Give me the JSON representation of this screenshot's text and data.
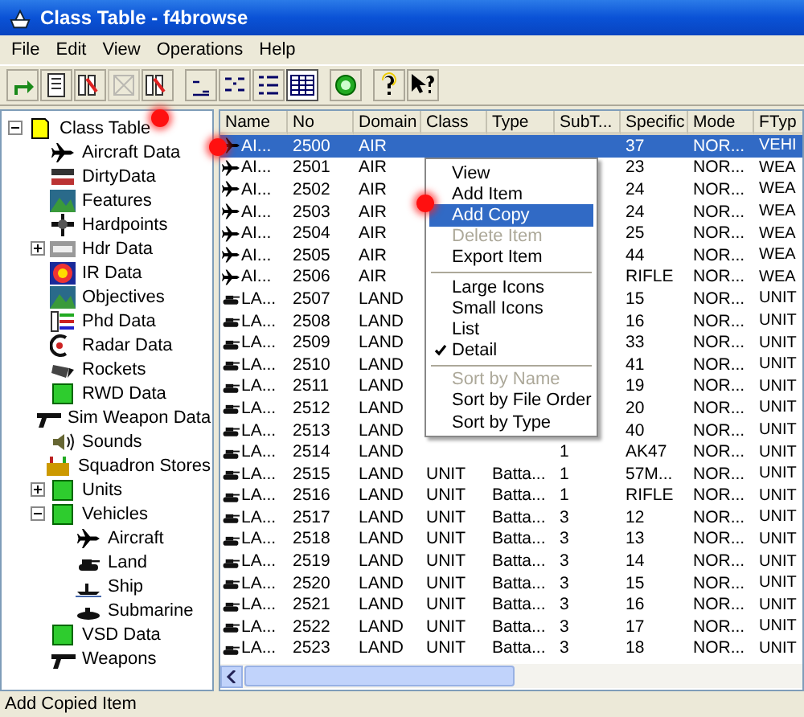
{
  "window": {
    "title": "Class Table - f4browse"
  },
  "menu": [
    "File",
    "Edit",
    "View",
    "Operations",
    "Help"
  ],
  "toolbar": [
    {
      "selected": false,
      "disabled": false
    },
    {
      "selected": false,
      "disabled": false
    },
    {
      "selected": false,
      "disabled": false
    },
    {
      "selected": false,
      "disabled": true
    },
    {
      "selected": false,
      "disabled": false
    },
    {
      "selected": false,
      "disabled": false
    },
    {
      "selected": false,
      "disabled": false
    },
    {
      "selected": false,
      "disabled": false
    },
    {
      "selected": true,
      "disabled": false
    },
    {
      "selected": false,
      "disabled": false
    },
    {
      "selected": false,
      "disabled": false
    },
    {
      "selected": false,
      "disabled": false
    }
  ],
  "tree": {
    "label": "Class Table",
    "expanded": true,
    "selected": false,
    "children": [
      {
        "label": "Aircraft Data"
      },
      {
        "label": "DirtyData"
      },
      {
        "label": "Features"
      },
      {
        "label": "Hardpoints"
      },
      {
        "label": "Hdr Data",
        "expanded": false
      },
      {
        "label": "IR Data"
      },
      {
        "label": "Objectives"
      },
      {
        "label": "Phd Data"
      },
      {
        "label": "Radar Data"
      },
      {
        "label": "Rockets"
      },
      {
        "label": "RWD Data"
      },
      {
        "label": "Sim Weapon Data"
      },
      {
        "label": "Sounds"
      },
      {
        "label": "Squadron Stores"
      },
      {
        "label": "Units",
        "expanded": false
      },
      {
        "label": "Vehicles",
        "expanded": true,
        "children": [
          {
            "label": "Aircraft"
          },
          {
            "label": "Land"
          },
          {
            "label": "Ship"
          },
          {
            "label": "Submarine"
          }
        ]
      },
      {
        "label": "VSD Data"
      },
      {
        "label": "Weapons"
      }
    ]
  },
  "table": {
    "columns": [
      "Name",
      "No",
      "Domain",
      "Class",
      "Type",
      "SubT...",
      "Specific",
      "Mode",
      "FTyp"
    ],
    "rows": [
      {
        "selected": true,
        "cells": [
          "AI...",
          "2500",
          "AIR",
          null,
          null,
          null,
          "37",
          "NOR...",
          "VEHI"
        ]
      },
      {
        "selected": false,
        "cells": [
          "AI...",
          "2501",
          "AIR",
          null,
          null,
          null,
          "23",
          "NOR...",
          "WEA"
        ]
      },
      {
        "selected": false,
        "cells": [
          "AI...",
          "2502",
          "AIR",
          null,
          null,
          null,
          "24",
          "NOR...",
          "WEA"
        ]
      },
      {
        "selected": false,
        "cells": [
          "AI...",
          "2503",
          "AIR",
          null,
          null,
          null,
          "24",
          "NOR...",
          "WEA"
        ]
      },
      {
        "selected": false,
        "cells": [
          "AI...",
          "2504",
          "AIR",
          null,
          null,
          null,
          "25",
          "NOR...",
          "WEA"
        ]
      },
      {
        "selected": false,
        "cells": [
          "AI...",
          "2505",
          "AIR",
          null,
          null,
          null,
          "44",
          "NOR...",
          "WEA"
        ]
      },
      {
        "selected": false,
        "cells": [
          "AI...",
          "2506",
          "AIR",
          null,
          null,
          null,
          "RIFLE",
          "NOR...",
          "WEA"
        ]
      },
      {
        "selected": false,
        "cells": [
          "LA...",
          "2507",
          "LAND",
          null,
          null,
          null,
          "15",
          "NOR...",
          "UNIT"
        ]
      },
      {
        "selected": false,
        "cells": [
          "LA...",
          "2508",
          "LAND",
          null,
          null,
          null,
          "16",
          "NOR...",
          "UNIT"
        ]
      },
      {
        "selected": false,
        "cells": [
          "LA...",
          "2509",
          "LAND",
          null,
          null,
          null,
          "33",
          "NOR...",
          "UNIT"
        ]
      },
      {
        "selected": false,
        "cells": [
          "LA...",
          "2510",
          "LAND",
          null,
          null,
          null,
          "41",
          "NOR...",
          "UNIT"
        ]
      },
      {
        "selected": false,
        "cells": [
          "LA...",
          "2511",
          "LAND",
          null,
          null,
          null,
          "19",
          "NOR...",
          "UNIT"
        ]
      },
      {
        "selected": false,
        "cells": [
          "LA...",
          "2512",
          "LAND",
          null,
          null,
          null,
          "20",
          "NOR...",
          "UNIT"
        ]
      },
      {
        "selected": false,
        "cells": [
          "LA...",
          "2513",
          "LAND",
          null,
          null,
          null,
          "40",
          "NOR...",
          "UNIT"
        ]
      },
      {
        "selected": false,
        "cells": [
          "LA...",
          "2514",
          "LAND",
          null,
          null,
          "1",
          "AK47",
          "NOR...",
          "UNIT"
        ]
      },
      {
        "selected": false,
        "cells": [
          "LA...",
          "2515",
          "LAND",
          "UNIT",
          "Batta...",
          "1",
          "57M...",
          "NOR...",
          "UNIT"
        ]
      },
      {
        "selected": false,
        "cells": [
          "LA...",
          "2516",
          "LAND",
          "UNIT",
          "Batta...",
          "1",
          "RIFLE",
          "NOR...",
          "UNIT"
        ]
      },
      {
        "selected": false,
        "cells": [
          "LA...",
          "2517",
          "LAND",
          "UNIT",
          "Batta...",
          "3",
          "12",
          "NOR...",
          "UNIT"
        ]
      },
      {
        "selected": false,
        "cells": [
          "LA...",
          "2518",
          "LAND",
          "UNIT",
          "Batta...",
          "3",
          "13",
          "NOR...",
          "UNIT"
        ]
      },
      {
        "selected": false,
        "cells": [
          "LA...",
          "2519",
          "LAND",
          "UNIT",
          "Batta...",
          "3",
          "14",
          "NOR...",
          "UNIT"
        ]
      },
      {
        "selected": false,
        "cells": [
          "LA...",
          "2520",
          "LAND",
          "UNIT",
          "Batta...",
          "3",
          "15",
          "NOR...",
          "UNIT"
        ]
      },
      {
        "selected": false,
        "cells": [
          "LA...",
          "2521",
          "LAND",
          "UNIT",
          "Batta...",
          "3",
          "16",
          "NOR...",
          "UNIT"
        ]
      },
      {
        "selected": false,
        "cells": [
          "LA...",
          "2522",
          "LAND",
          "UNIT",
          "Batta...",
          "3",
          "17",
          "NOR...",
          "UNIT"
        ]
      },
      {
        "selected": false,
        "cells": [
          "LA...",
          "2523",
          "LAND",
          "UNIT",
          "Batta...",
          "3",
          "18",
          "NOR...",
          "UNIT"
        ]
      }
    ]
  },
  "context_menu": [
    {
      "kind": "item",
      "label": "View",
      "selected": false,
      "disabled": false,
      "checked": false
    },
    {
      "kind": "item",
      "label": "Add Item",
      "selected": false,
      "disabled": false,
      "checked": false
    },
    {
      "kind": "item",
      "label": "Add Copy",
      "selected": true,
      "disabled": false,
      "checked": false
    },
    {
      "kind": "item",
      "label": "Delete Item",
      "selected": false,
      "disabled": true,
      "checked": false
    },
    {
      "kind": "item",
      "label": "Export Item",
      "selected": false,
      "disabled": false,
      "checked": false
    },
    {
      "kind": "separator"
    },
    {
      "kind": "item",
      "label": "Large Icons",
      "selected": false,
      "disabled": false,
      "checked": false
    },
    {
      "kind": "item",
      "label": "Small Icons",
      "selected": false,
      "disabled": false,
      "checked": false
    },
    {
      "kind": "item",
      "label": "List",
      "selected": false,
      "disabled": false,
      "checked": false
    },
    {
      "kind": "item",
      "label": "Detail",
      "selected": false,
      "disabled": false,
      "checked": true
    },
    {
      "kind": "separator"
    },
    {
      "kind": "item",
      "label": "Sort by Name",
      "selected": false,
      "disabled": true,
      "checked": false
    },
    {
      "kind": "item",
      "label": "Sort by File Order",
      "selected": false,
      "disabled": false,
      "checked": false
    },
    {
      "kind": "item",
      "label": "Sort by Type",
      "selected": false,
      "disabled": false,
      "checked": false
    }
  ],
  "status_bar": "Add Copied Item"
}
